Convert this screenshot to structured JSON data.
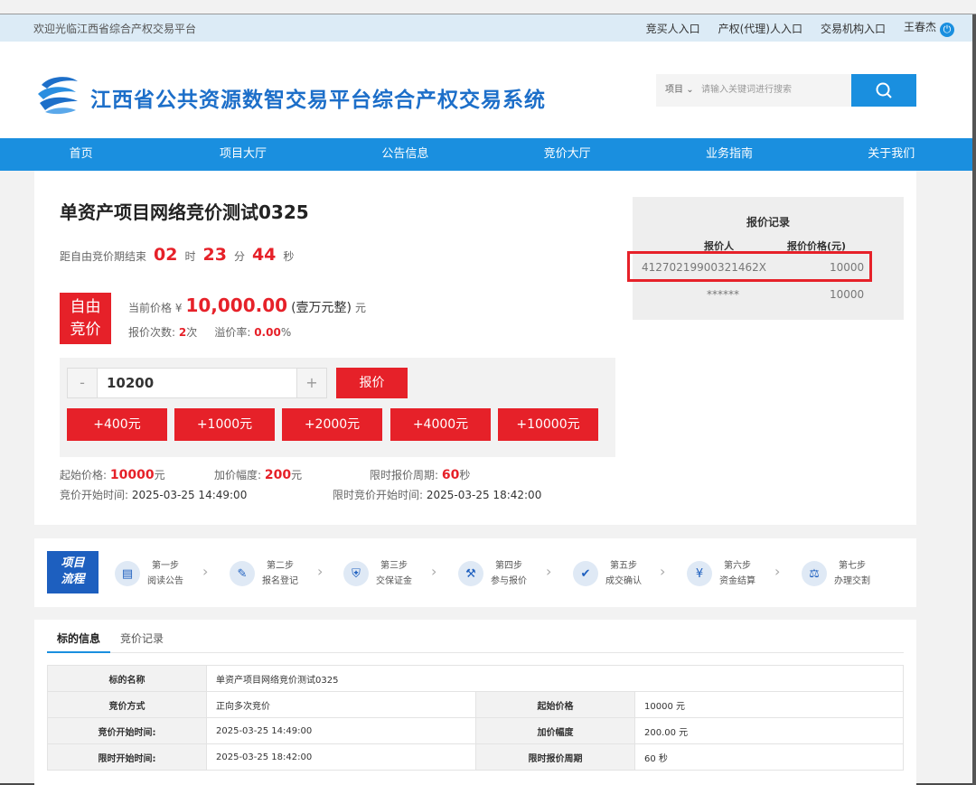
{
  "topbar": {
    "welcome": "欢迎光临江西省综合产权交易平台",
    "links": [
      "竞买人入口",
      "产权(代理)人入口",
      "交易机构入口"
    ],
    "user": "王春杰"
  },
  "header": {
    "title": "江西省公共资源数智交易平台综合产权交易系统",
    "search_scope": "项目",
    "search_placeholder": "请输入关键词进行搜索"
  },
  "nav": [
    "首页",
    "项目大厅",
    "公告信息",
    "竞价大厅",
    "业务指南",
    "关于我们"
  ],
  "project": {
    "title": "单资产项目网络竞价测试0325",
    "countdown_label": "距自由竞价期结束",
    "hours": "02",
    "hours_unit": "时",
    "minutes": "23",
    "minutes_unit": "分",
    "seconds": "44",
    "seconds_unit": "秒",
    "badge_line1": "自由",
    "badge_line2": "竞价",
    "current_price_label": "当前价格 ¥",
    "current_price": "10,000.00",
    "current_price_cn": "(壹万元整)",
    "current_price_unit": "元",
    "bid_count_label": "报价次数:",
    "bid_count": "2",
    "bid_count_unit": "次",
    "premium_label": "溢价率:",
    "premium": "0.00",
    "premium_unit": "%"
  },
  "bid": {
    "minus": "-",
    "value": "10200",
    "plus": "+",
    "submit": "报价",
    "increments": [
      "+400元",
      "+1000元",
      "+2000元",
      "+4000元",
      "+10000元"
    ]
  },
  "details": {
    "start_price_label": "起始价格:",
    "start_price": "10000",
    "start_price_unit": "元",
    "step_label": "加价幅度:",
    "step": "200",
    "step_unit": "元",
    "period_label": "限时报价周期:",
    "period": "60",
    "period_unit": "秒",
    "start_time_label": "竞价开始时间:",
    "start_time": "2025-03-25 14:49:00",
    "limit_start_label": "限时竞价开始时间:",
    "limit_start": "2025-03-25 18:42:00"
  },
  "records": {
    "title": "报价记录",
    "col_bidder": "报价人",
    "col_price": "报价价格(元)",
    "rows": [
      {
        "bidder": "41270219900321462X",
        "price": "10000"
      },
      {
        "bidder": "******",
        "price": "10000"
      }
    ]
  },
  "flow": {
    "badge_line1": "项目",
    "badge_line2": "流程",
    "steps": [
      {
        "step": "第一步",
        "name": "阅读公告"
      },
      {
        "step": "第二步",
        "name": "报名登记"
      },
      {
        "step": "第三步",
        "name": "交保证金"
      },
      {
        "step": "第四步",
        "name": "参与报价"
      },
      {
        "step": "第五步",
        "name": "成交确认"
      },
      {
        "step": "第六步",
        "name": "资金结算"
      },
      {
        "step": "第七步",
        "name": "办理交割"
      }
    ]
  },
  "tabs": [
    "标的信息",
    "竞价记录"
  ],
  "info_table": {
    "name_label": "标的名称",
    "name": "单资产项目网络竞价测试0325",
    "method_label": "竞价方式",
    "method": "正向多次竞价",
    "start_price_label": "起始价格",
    "start_price": "10000 元",
    "start_time_label": "竞价开始时间:",
    "start_time": "2025-03-25 14:49:00",
    "step_label": "加价幅度",
    "step": "200.00 元",
    "limit_start_label": "限时开始时间:",
    "limit_start": "2025-03-25 18:42:00",
    "period_label": "限时报价周期",
    "period": "60 秒"
  }
}
